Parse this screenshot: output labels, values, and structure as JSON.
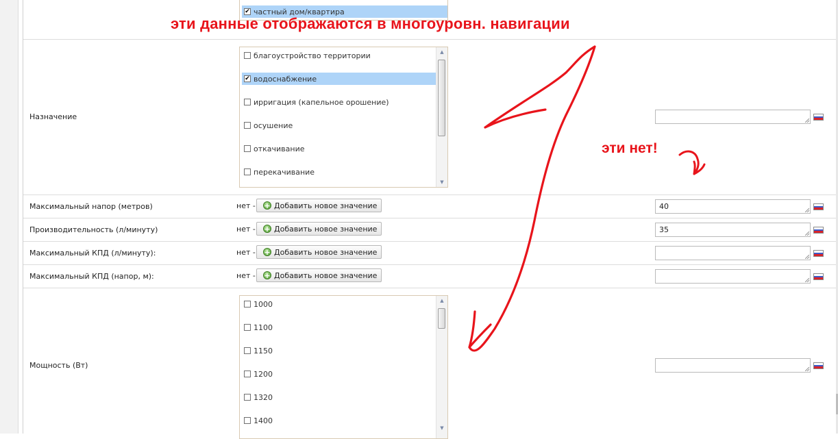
{
  "top_list": {
    "selected_item": "частный дом/квартира"
  },
  "annotations": {
    "top_note": "эти данные отображаются в многоуровн. навигации",
    "side_note": "эти нет!"
  },
  "fields": {
    "naznachenie": {
      "label": "Назначение",
      "options": [
        {
          "label": "благоустройство территории",
          "checked": false
        },
        {
          "label": "водоснабжение",
          "checked": true
        },
        {
          "label": "ирригация (капельное орошение)",
          "checked": false
        },
        {
          "label": "осушение",
          "checked": false
        },
        {
          "label": "откачивание",
          "checked": false
        },
        {
          "label": "перекачивание",
          "checked": false
        }
      ],
      "value": ""
    },
    "max_napor": {
      "label": "Максимальный напор (метров)",
      "net": "нет -",
      "add_button": "Добавить новое значение",
      "value": "40"
    },
    "proizvoditelnost": {
      "label": "Производительность (л/минуту)",
      "net": "нет -",
      "add_button": "Добавить новое значение",
      "value": "35"
    },
    "max_kpd_l": {
      "label": "Максимальный КПД (л/минуту):",
      "net": "нет -",
      "add_button": "Добавить новое значение",
      "value": ""
    },
    "max_kpd_napor": {
      "label": "Максимальный КПД (напор, м):",
      "net": "нет -",
      "add_button": "Добавить новое значение",
      "value": ""
    },
    "moshchnost": {
      "label": "Мощность (Вт)",
      "options": [
        {
          "label": "1000",
          "checked": false
        },
        {
          "label": "1100",
          "checked": false
        },
        {
          "label": "1150",
          "checked": false
        },
        {
          "label": "1200",
          "checked": false
        },
        {
          "label": "1320",
          "checked": false
        },
        {
          "label": "1400",
          "checked": false
        }
      ],
      "value": ""
    }
  },
  "colors": {
    "annotation_red": "#e8141b",
    "selection_blue": "#aed4f8"
  },
  "icons": {
    "add": "plus-circle-icon",
    "language": "russian-flag-icon"
  }
}
